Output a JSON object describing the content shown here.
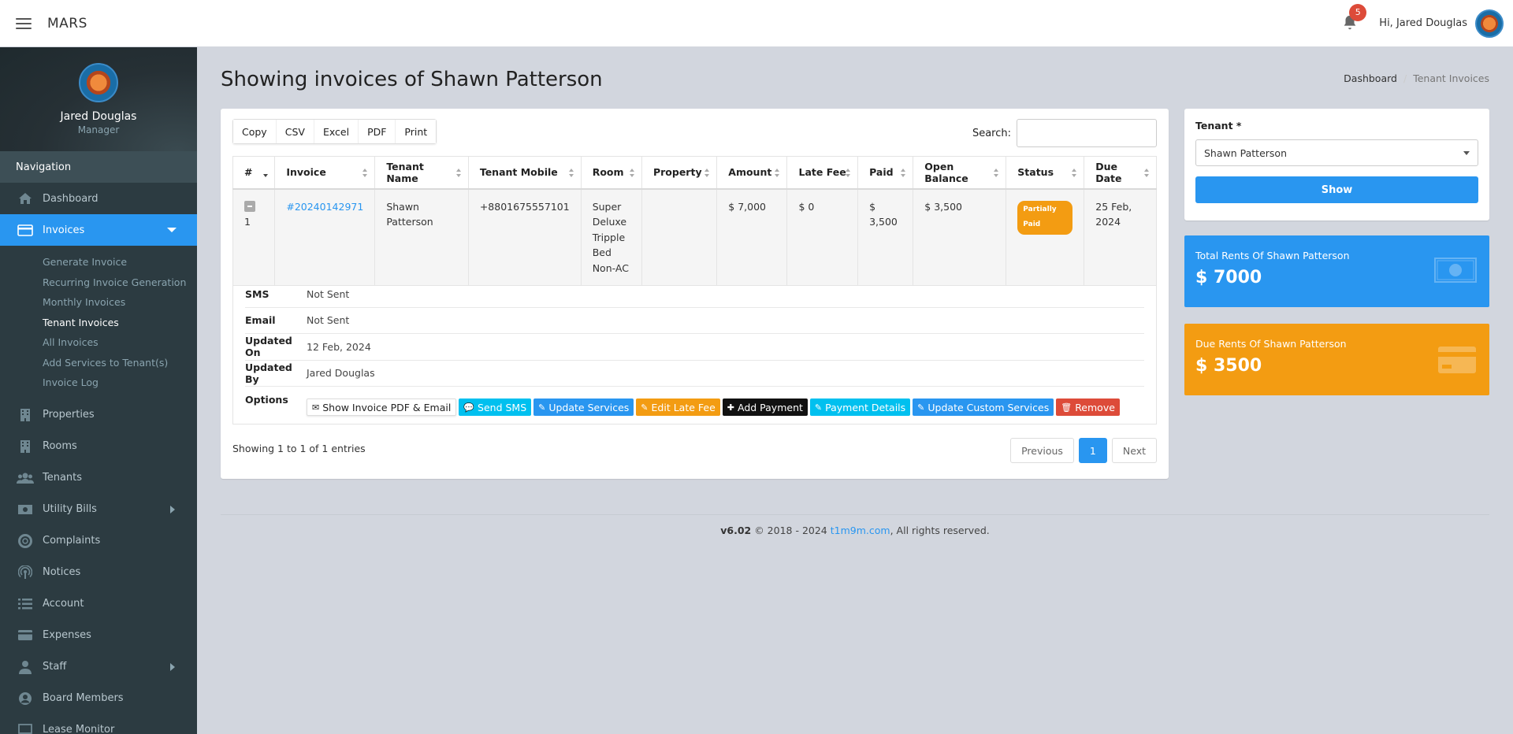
{
  "app": {
    "brand": "MARS"
  },
  "topbar": {
    "notification_count": "5",
    "greeting": "Hi, Jared Douglas"
  },
  "user": {
    "name": "Jared Douglas",
    "role": "Manager"
  },
  "sidebar": {
    "header": "Navigation",
    "dashboard": "Dashboard",
    "invoices": "Invoices",
    "submenu": [
      "Generate Invoice",
      "Recurring Invoice Generation",
      "Monthly Invoices",
      "Tenant Invoices",
      "All Invoices",
      "Add Services to Tenant(s)",
      "Invoice Log"
    ],
    "after": [
      "Properties",
      "Rooms",
      "Tenants",
      "Utility Bills",
      "Complaints",
      "Notices",
      "Account",
      "Expenses",
      "Staff",
      "Board Members",
      "Lease Monitor"
    ]
  },
  "page": {
    "title": "Showing invoices of Shawn Patterson",
    "breadcrumb": [
      "Dashboard",
      "Tenant Invoices"
    ]
  },
  "table_tools": {
    "buttons": [
      "Copy",
      "CSV",
      "Excel",
      "PDF",
      "Print"
    ],
    "search_label": "Search:",
    "search_value": ""
  },
  "table": {
    "headers": [
      "#",
      "Invoice",
      "Tenant Name",
      "Tenant Mobile",
      "Room",
      "Property",
      "Amount",
      "Late Fee",
      "Paid",
      "Open Balance",
      "Status",
      "Due Date"
    ],
    "row": {
      "num": "1",
      "invoice": "#20240142971",
      "tenant_name": "Shawn Patterson",
      "mobile": "+8801675557101",
      "room": "Super Deluxe Tripple Bed Non-AC",
      "property": "",
      "amount": "$ 7,000",
      "late_fee": "$ 0",
      "paid": "$ 3,500",
      "open_balance": "$ 3,500",
      "status": "Partially Paid",
      "due_date": "25 Feb, 2024"
    }
  },
  "details": {
    "sms_label": "SMS",
    "sms_value": "Not Sent",
    "email_label": "Email",
    "email_value": "Not Sent",
    "updated_on_label": "Updated On",
    "updated_on_value": "12 Feb, 2024",
    "updated_by_label": "Updated By",
    "updated_by_value": "Jared Douglas",
    "options_label": "Options",
    "options": [
      "Show Invoice PDF & Email",
      "Send SMS",
      "Update Services",
      "Edit Late Fee",
      "Add Payment",
      "Payment Details",
      "Update Custom Services",
      "Remove"
    ]
  },
  "pagination": {
    "info": "Showing 1 to 1 of 1 entries",
    "previous": "Previous",
    "page": "1",
    "next": "Next"
  },
  "tenant_box": {
    "label": "Tenant *",
    "selected": "Shawn Patterson",
    "show_button": "Show"
  },
  "stats": {
    "total_title": "Total Rents Of Shawn Patterson",
    "total_value": "$ 7000",
    "due_title": "Due Rents Of Shawn Patterson",
    "due_value": "$ 3500"
  },
  "footer": {
    "version": "v6.02",
    "copyright": "© 2018 - 2024",
    "link": "t1m9m.com",
    "rights": ", All rights reserved."
  },
  "colors": {
    "primary": "#2996f0",
    "warning": "#f39c12",
    "danger": "#dd4b39",
    "info": "#00c0ef",
    "sidebar": "#2c3b41"
  }
}
